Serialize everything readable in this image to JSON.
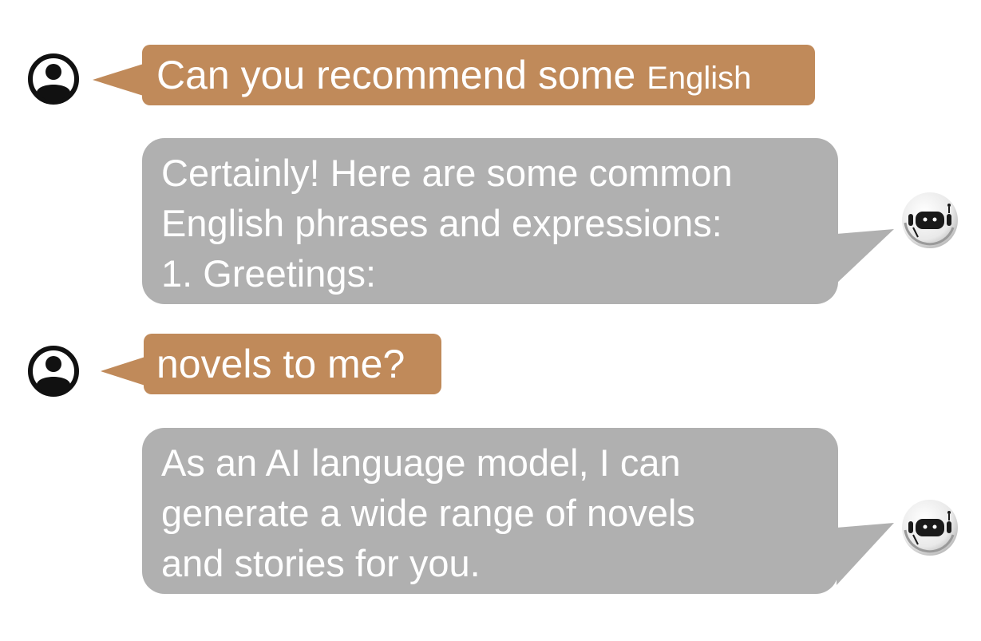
{
  "messages": [
    {
      "role": "user",
      "avatar_icon": "user-icon",
      "text_main": "Can you recommend some",
      "text_small": "English"
    },
    {
      "role": "assistant",
      "avatar_icon": "robot-icon",
      "lines": [
        "Certainly! Here are some common",
        "English phrases and expressions:",
        "1. Greetings:"
      ]
    },
    {
      "role": "user",
      "avatar_icon": "user-icon",
      "text": "novels to me?"
    },
    {
      "role": "assistant",
      "avatar_icon": "robot-icon",
      "lines": [
        "As an AI language model, I can",
        "generate a wide range of novels",
        "and stories for you."
      ]
    }
  ],
  "colors": {
    "user_bubble": "#c08a5a",
    "assistant_bubble": "#b0b0b0",
    "text": "#ffffff",
    "avatar": "#1a1a1a"
  }
}
